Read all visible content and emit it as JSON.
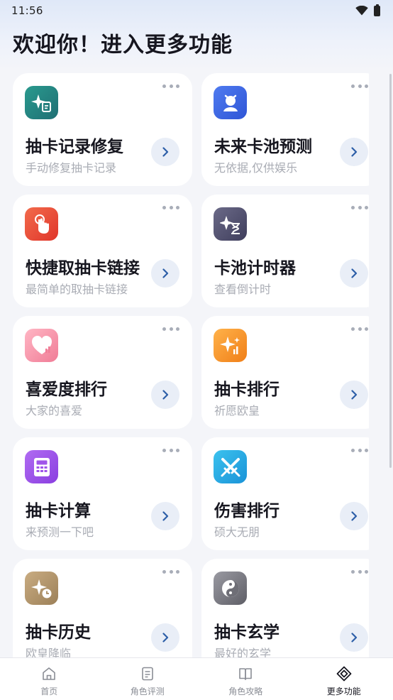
{
  "status_bar": {
    "time": "11:56"
  },
  "header": {
    "title": "欢迎你！进入更多功能"
  },
  "cards": [
    {
      "title": "抽卡记录修复",
      "subtitle": "手动修复抽卡记录",
      "icon": "gacha-repair-icon",
      "color_from": "#2a9a8e",
      "color_to": "#1f6f74"
    },
    {
      "title": "未来卡池预测",
      "subtitle": "无依据,仅供娱乐",
      "icon": "future-pool-icon",
      "color_from": "#4f7bf0",
      "color_to": "#2f55d6"
    },
    {
      "title": "快捷取抽卡链接",
      "subtitle": "最简单的取抽卡链接",
      "icon": "tap-hand-icon",
      "color_from": "#f26b4c",
      "color_to": "#e0352a"
    },
    {
      "title": "卡池计时器",
      "subtitle": "查看倒计时",
      "icon": "hourglass-sparkle-icon",
      "color_from": "#6b6a88",
      "color_to": "#3f3e5c"
    },
    {
      "title": "喜爱度排行",
      "subtitle": "大家的喜爱",
      "icon": "heart-chart-icon",
      "color_from": "#ffb6c4",
      "color_to": "#f07c96"
    },
    {
      "title": "抽卡排行",
      "subtitle": "祈愿欧皇",
      "icon": "sparkle-chart-icon",
      "color_from": "#ffb24a",
      "color_to": "#f07f18"
    },
    {
      "title": "抽卡计算",
      "subtitle": "来预测一下吧",
      "icon": "calculator-icon",
      "color_from": "#b06cf2",
      "color_to": "#8a3ee0"
    },
    {
      "title": "伤害排行",
      "subtitle": "硕大无朋",
      "icon": "crossed-swords-icon",
      "color_from": "#3cc2ee",
      "color_to": "#1a93d8"
    },
    {
      "title": "抽卡历史",
      "subtitle": "欧皇降临",
      "icon": "sparkle-clock-icon",
      "color_from": "#c9ac82",
      "color_to": "#9c8058"
    },
    {
      "title": "抽卡玄学",
      "subtitle": "最好的玄学",
      "icon": "yin-yang-icon",
      "color_from": "#9a9aa2",
      "color_to": "#5e5e66"
    }
  ],
  "nav": [
    {
      "label": "首页",
      "icon": "home-icon",
      "active": false
    },
    {
      "label": "角色评测",
      "icon": "review-icon",
      "active": false
    },
    {
      "label": "角色攻略",
      "icon": "book-icon",
      "active": false
    },
    {
      "label": "更多功能",
      "icon": "more-features-icon",
      "active": true
    }
  ]
}
